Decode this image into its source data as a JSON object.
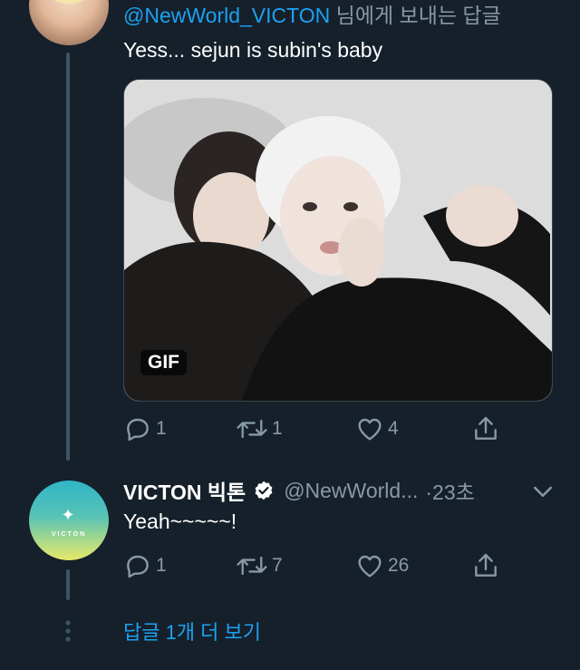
{
  "reply": {
    "mention": "@NewWorld_VICTON",
    "suffix": " 님에게 보내는 답글",
    "text": "Yess... sejun is subin's baby",
    "media_badge": "GIF",
    "actions": {
      "reply": "1",
      "retweet": "1",
      "like": "4"
    }
  },
  "tweet": {
    "author_name": "VICTON 빅톤",
    "handle": "@NewWorld...",
    "time": "·23초",
    "text": "Yeah~~~~~!",
    "avatar_text": "VICTON",
    "actions": {
      "reply": "1",
      "retweet": "7",
      "like": "26"
    }
  },
  "show_more": "답글 1개 더 보기",
  "colors": {
    "background": "#15202b",
    "accent": "#1da1f2",
    "secondary_text": "#8899a6",
    "thread_line": "#3d5466"
  },
  "icons": [
    "reply-icon",
    "retweet-icon",
    "like-icon",
    "share-icon",
    "verified-badge-icon",
    "chevron-down-icon",
    "more-dots-icon"
  ]
}
